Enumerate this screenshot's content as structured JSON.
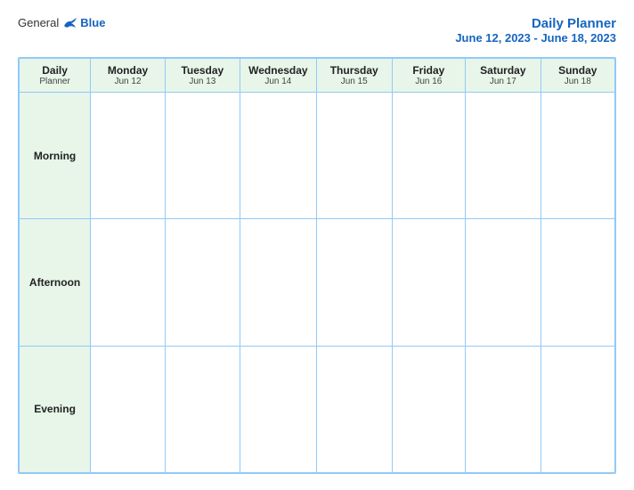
{
  "header": {
    "logo_general": "General",
    "logo_blue": "Blue",
    "title_main": "Daily Planner",
    "title_sub": "June 12, 2023 - June 18, 2023"
  },
  "table": {
    "header_col": {
      "line1": "Daily",
      "line2": "Planner"
    },
    "days": [
      {
        "name": "Monday",
        "date": "Jun 12"
      },
      {
        "name": "Tuesday",
        "date": "Jun 13"
      },
      {
        "name": "Wednesday",
        "date": "Jun 14"
      },
      {
        "name": "Thursday",
        "date": "Jun 15"
      },
      {
        "name": "Friday",
        "date": "Jun 16"
      },
      {
        "name": "Saturday",
        "date": "Jun 17"
      },
      {
        "name": "Sunday",
        "date": "Jun 18"
      }
    ],
    "rows": [
      {
        "label": "Morning"
      },
      {
        "label": "Afternoon"
      },
      {
        "label": "Evening"
      }
    ]
  }
}
